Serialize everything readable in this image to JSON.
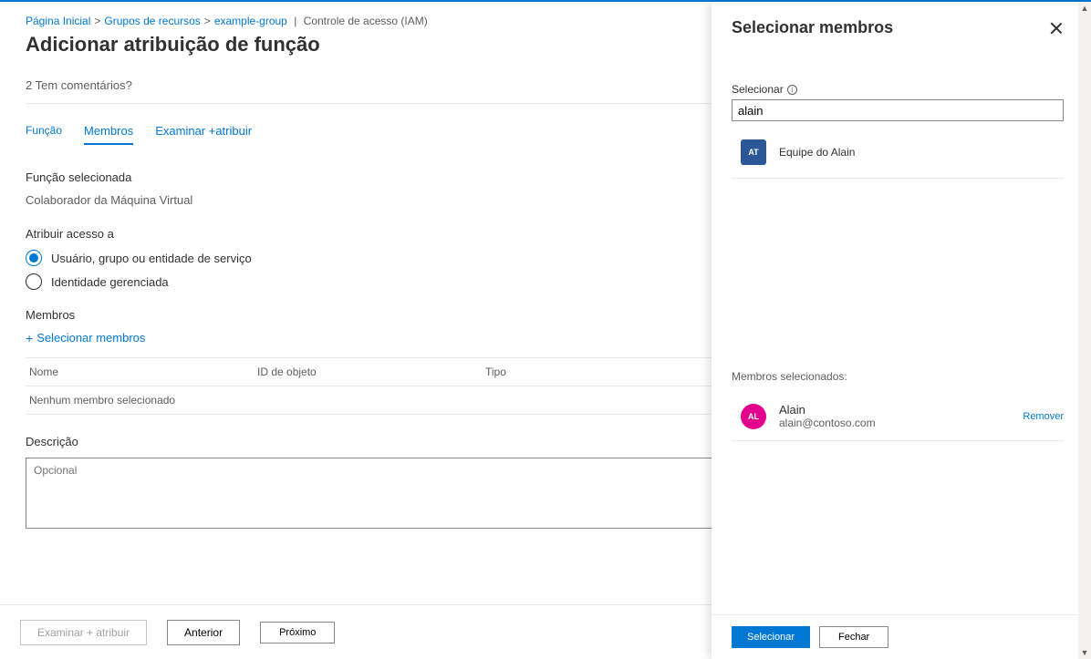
{
  "breadcrumb": {
    "home": "Página Inicial",
    "groups": "Grupos de recursos",
    "group_name": "example-group",
    "iam": "Controle de acesso (IAM)"
  },
  "page_title": "Adicionar atribuição de função",
  "feedback_prompt": "2 Tem comentários?",
  "tabs": {
    "role": "Função",
    "members": "Membros",
    "review": "Examinar +atribuir"
  },
  "role_section": {
    "label": "Função selecionada",
    "value": "Colaborador da Máquina Virtual"
  },
  "assign_section": {
    "label": "Atribuir acesso a",
    "option_user": "Usuário, grupo ou entidade de serviço",
    "option_identity": "Identidade gerenciada"
  },
  "members_section": {
    "label": "Membros",
    "select_link": "Selecionar membros",
    "col_name": "Nome",
    "col_id": "ID de objeto",
    "col_type": "Tipo",
    "empty_text": "Nenhum membro selecionado"
  },
  "description": {
    "label": "Descrição",
    "placeholder": "Opcional"
  },
  "footer_buttons": {
    "review": "Examinar +   atribuir",
    "previous": "Anterior",
    "next": "Próximo"
  },
  "panel": {
    "title": "Selecionar membros",
    "select_label": "Selecionar",
    "search_value": "alain",
    "result": {
      "initials": "AT",
      "name": "Equipe do Alain"
    },
    "selected_label": "Membros selecionados:",
    "selected": {
      "initials": "AL",
      "name": "Alain",
      "email": "alain@contoso.com",
      "remove": "Remover"
    },
    "btn_select": "Selecionar",
    "btn_close": "Fechar"
  }
}
